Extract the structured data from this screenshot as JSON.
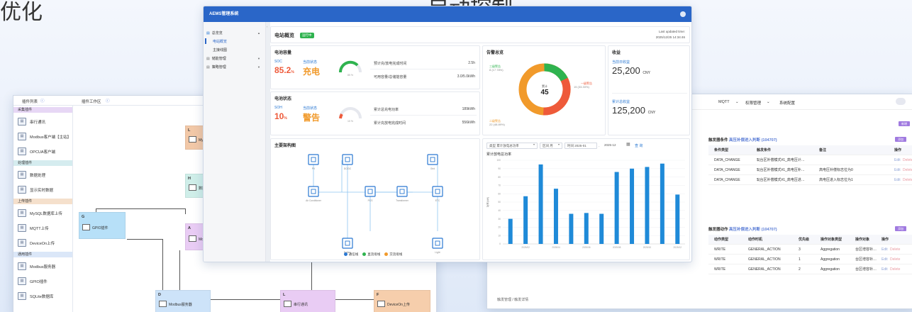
{
  "bg_text": {
    "left": "优化",
    "center": "自动控制"
  },
  "leftwin": {
    "header_left": "插件列表",
    "header_mid": "插件工作区",
    "sections": [
      {
        "label": "采集插件",
        "color": "p",
        "items": [
          "串行通讯",
          "Modbus客户端【主站】",
          "OPCUA客户端"
        ]
      },
      {
        "label": "处理插件",
        "color": "g",
        "items": [
          "数据处理",
          "显示实时数据"
        ]
      },
      {
        "label": "上传插件",
        "color": "o",
        "items": [
          "MySQL数据库上传",
          "MQTT上传",
          "DeviceOn上传"
        ]
      },
      {
        "label": "通用插件",
        "color": "b",
        "items": [
          "Modbus服务器",
          "GPIO插件",
          "SQLite数据库"
        ]
      }
    ],
    "nodes": {
      "L1": {
        "letter": "L",
        "text": "MySQL数据库"
      },
      "H": {
        "letter": "H",
        "text": "数据处理"
      },
      "G": {
        "letter": "G",
        "text": "GPIO插件"
      },
      "A": {
        "letter": "A",
        "text": "Modbus客户端"
      },
      "D": {
        "letter": "D",
        "text": "Modbus服务器"
      },
      "L2": {
        "letter": "L",
        "text": "串行通讯"
      },
      "F": {
        "letter": "F",
        "text": "DeviceOn上传"
      }
    }
  },
  "rightwin": {
    "nav": [
      "MQTT",
      "权限管理",
      "系统配置"
    ],
    "purple1": "新增",
    "purple2": "添加",
    "purple3": "添加",
    "cond_title_prefix": "触发器条件",
    "cond_title_link": "高压补偿进入判断 (104707)",
    "cond_headers": [
      "条件类型",
      "触发条件",
      "备注",
      "操作"
    ],
    "cond_rows": [
      {
        "type": "DATA_CHANGE",
        "cond": "$(台区补偿模式#1_高电压计…",
        "note": "",
        "edit": "Edit",
        "del": "Delete"
      },
      {
        "type": "DATA_CHANGE",
        "cond": "$(台区补偿模式#1_高电压补…",
        "note": "高电压补偿标志位为0",
        "edit": "Edit",
        "del": "Delete"
      },
      {
        "type": "DATA_CHANGE",
        "cond": "$(台区补偿模式#1_高电压进…",
        "note": "高电压进入标志位为1",
        "edit": "Edit",
        "del": "Delete"
      }
    ],
    "act_title_prefix": "触发器动作",
    "act_title_link": "高压补偿进入判断 (104707)",
    "act_headers": [
      "动作类型",
      "动作时机",
      "优先级",
      "操作对象类型",
      "操作对象",
      "操作"
    ],
    "act_rows": [
      {
        "type": "WRITE",
        "timing": "GENERAL_ACTION",
        "pri": "3",
        "otype": "Aggregation",
        "obj": "台区增容补…",
        "edit": "Edit",
        "del": "Delete"
      },
      {
        "type": "WRITE",
        "timing": "GENERAL_ACTION",
        "pri": "1",
        "otype": "Aggregation",
        "obj": "台区增容补…",
        "edit": "Edit",
        "del": "Delete"
      },
      {
        "type": "WRITE",
        "timing": "GENERAL_ACTION",
        "pri": "2",
        "otype": "Aggregation",
        "obj": "台区增容补…",
        "edit": "Edit",
        "del": "Delete"
      }
    ],
    "breadcrumb": "触发管理 / 触发详情"
  },
  "main": {
    "app_title": "AEMS管理系统",
    "side": [
      {
        "label": "总览览",
        "caret": "▲",
        "level": 0
      },
      {
        "label": "电站概览",
        "level": 1,
        "active": true
      },
      {
        "label": "主接线图",
        "level": 1
      },
      {
        "label": "储能管理",
        "caret": "▼",
        "level": 0
      },
      {
        "label": "策略管理",
        "caret": "▼",
        "level": 0
      }
    ],
    "page_title": "电站概览",
    "status_tag": "运行中",
    "updated_label": "Last updated time:",
    "updated_time": "2025/12/25 14:34:46",
    "battery_capacity": {
      "title": "电池容量",
      "soc_label": "SOC",
      "soc_value": "85.2",
      "soc_unit": "%",
      "state_label": "当前状态",
      "state_value": "充电",
      "gauge_pct": "85 %",
      "rows": [
        {
          "k": "预计充/放电完成时间",
          "v": "2.5h"
        },
        {
          "k": "可用容量/总储能容量",
          "v": "3.0/5.0kWh"
        }
      ]
    },
    "battery_state": {
      "title": "电池状态",
      "soh_label": "SOH",
      "soh_value": "10",
      "soh_unit": "%",
      "state_label": "当前状态",
      "state_value": "警告",
      "gauge_pct": "10 %",
      "rows": [
        {
          "k": "累计总充电功率",
          "v": "189kWh"
        },
        {
          "k": "累计充放电完成时间",
          "v": "556kWh"
        }
      ]
    },
    "alarms": {
      "title": "告警总览",
      "total_label": "累计",
      "total": "45",
      "l1": "三级警告",
      "l1v": "8 (17.78%)",
      "l2": "一级警告",
      "l2v": "15 (33.33%)",
      "l3": "二级警告",
      "l3v": "22 (48.89%)"
    },
    "income": {
      "title": "收益",
      "day_label": "当前日收益",
      "day_value": "25,200",
      "unit": "CNY",
      "total_label": "累计总收益",
      "total_value": "125,200"
    },
    "arch": {
      "title": "主要架构图",
      "nodes": [
        "PV",
        "DC/DC",
        "Grid",
        "Air Conditioner",
        "PCS",
        "Transformer",
        "ETC",
        "Battery",
        "Light"
      ],
      "legend": [
        {
          "label": "通信线",
          "color": "#2a78d2"
        },
        {
          "label": "直流母线",
          "color": "#2fb34f"
        },
        {
          "label": "交流母线",
          "color": "#f19a2b"
        }
      ]
    },
    "chart_controls": {
      "type_label": "类型 累计放电总功率",
      "range_label": "区间 月",
      "time_label": "时间 2025-01",
      "to_label": "2025-12",
      "query": "查 询"
    },
    "chart_data": {
      "type": "bar",
      "title": "累计放电总功率",
      "ylabel": "功率(kW)",
      "ylim": [
        0,
        100
      ],
      "yticks": [
        "0",
        "10",
        "20",
        "30",
        "40",
        "50",
        "60",
        "70",
        "80",
        "90",
        "100"
      ],
      "categories": [
        "2025/01",
        "2025/02",
        "2025/03",
        "2025/04",
        "2025/05",
        "2025/06",
        "2025/07",
        "2025/08",
        "2025/09",
        "2025/10",
        "2025/11",
        "2025/12"
      ],
      "xticks_shown": [
        "2025/02",
        "2025/04",
        "2025/06",
        "2025/08",
        "2025/10",
        "2025/12"
      ],
      "values": [
        30,
        57,
        95,
        66,
        36,
        37,
        36,
        86,
        90,
        92,
        96,
        59
      ],
      "bar_color": "#1f8ad8"
    }
  }
}
